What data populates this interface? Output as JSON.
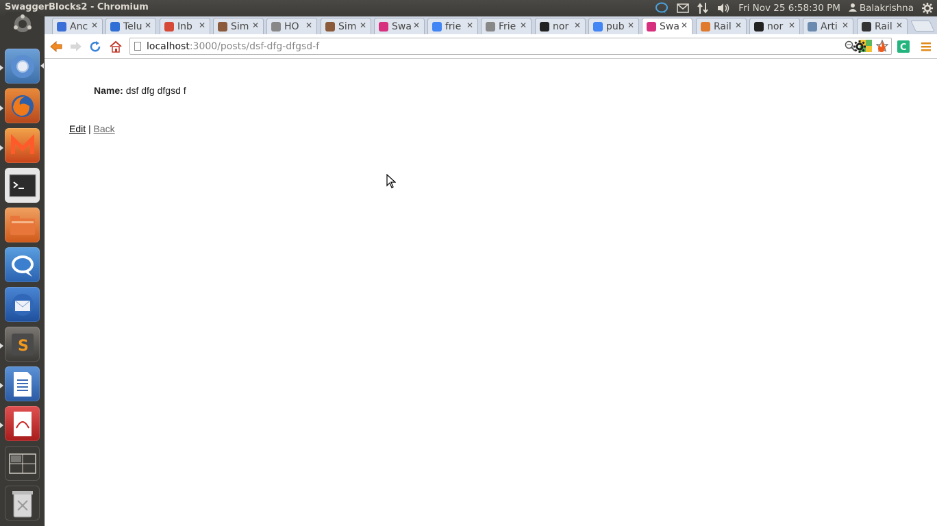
{
  "panel": {
    "window_title": "SwaggerBlocks2 - Chromium",
    "clock": "Fri Nov 25  6:58:30 PM",
    "user": "Balakrishna"
  },
  "tabs": [
    {
      "label": "Anc",
      "icon": "globe-icon",
      "color": "#3a6fd8"
    },
    {
      "label": "Telu",
      "icon": "telugu-icon",
      "color": "#2f6fd6"
    },
    {
      "label": "Inb",
      "icon": "gmail-icon",
      "color": "#d64937"
    },
    {
      "label": "Sim",
      "icon": "photo-icon",
      "color": "#8a5a3a"
    },
    {
      "label": "HO",
      "icon": "page-icon",
      "color": "#888888"
    },
    {
      "label": "Sim",
      "icon": "photo-icon",
      "color": "#8a5a3a"
    },
    {
      "label": "Swa",
      "icon": "d-icon",
      "color": "#d6307e"
    },
    {
      "label": "frie",
      "icon": "google-icon",
      "color": "#4285f4"
    },
    {
      "label": "Frie",
      "icon": "page-icon",
      "color": "#888888"
    },
    {
      "label": "nor",
      "icon": "github-icon",
      "color": "#222222"
    },
    {
      "label": "pub",
      "icon": "google-icon",
      "color": "#4285f4"
    },
    {
      "label": "Swa",
      "icon": "d-icon",
      "color": "#d6307e",
      "active": true
    },
    {
      "label": "Rail",
      "icon": "rails-icon",
      "color": "#e07a2e"
    },
    {
      "label": "nor",
      "icon": "github-icon",
      "color": "#222222"
    },
    {
      "label": "Arti",
      "icon": "doc-icon",
      "color": "#6a8ab0"
    },
    {
      "label": "Rail",
      "icon": "o-icon",
      "color": "#333333"
    }
  ],
  "address": {
    "host": "localhost",
    "path": ":3000/posts/dsf-dfg-dfgsd-f"
  },
  "page": {
    "name_label": "Name:",
    "name_value": "dsf dfg dfgsd f",
    "edit_link": "Edit",
    "separator": "|",
    "back_link": "Back"
  },
  "launcher": [
    {
      "name": "dash-home-icon"
    },
    {
      "name": "chromium-icon"
    },
    {
      "name": "firefox-icon"
    },
    {
      "name": "mendeley-icon"
    },
    {
      "name": "terminal-icon"
    },
    {
      "name": "files-icon"
    },
    {
      "name": "empathy-icon"
    },
    {
      "name": "thunderbird-icon"
    },
    {
      "name": "sublime-text-icon"
    },
    {
      "name": "libreoffice-writer-icon"
    },
    {
      "name": "evince-icon"
    },
    {
      "name": "workspace-switcher-icon"
    },
    {
      "name": "trash-icon"
    }
  ]
}
